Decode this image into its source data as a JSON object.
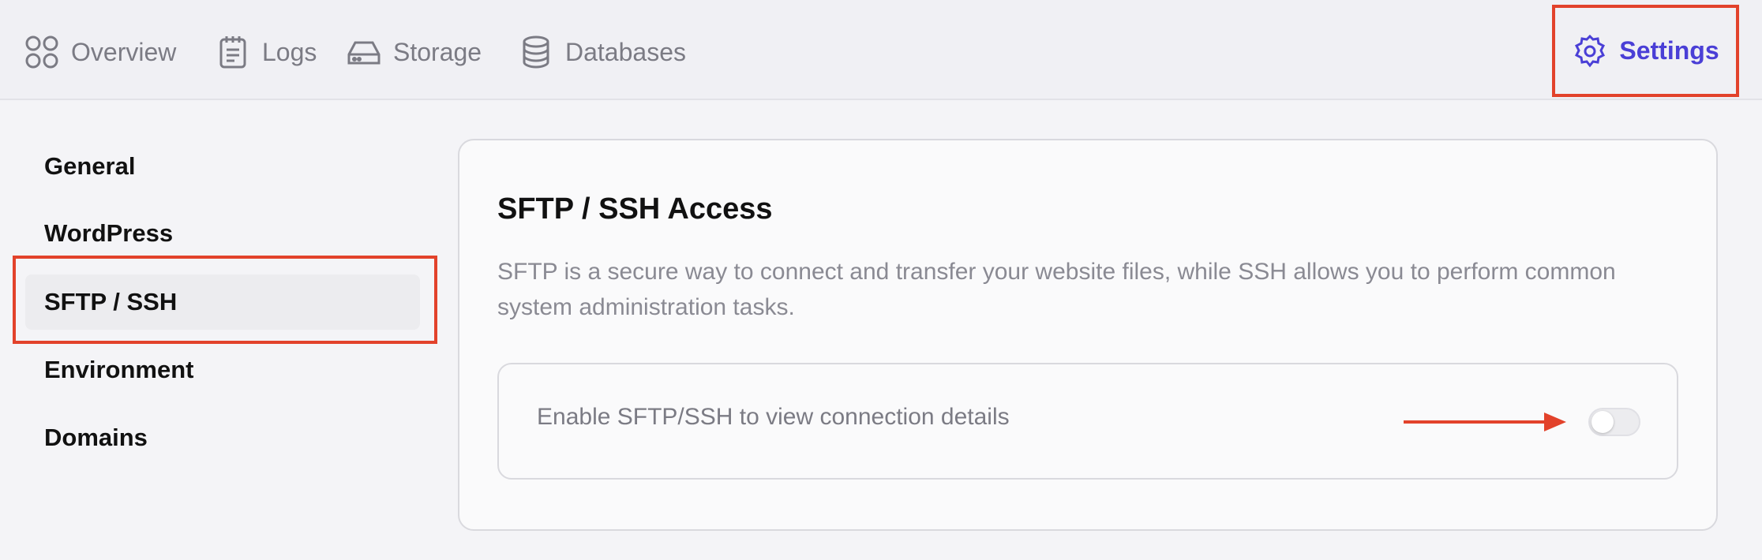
{
  "topnav": {
    "items": [
      {
        "label": "Overview",
        "icon": "overview-grid-icon"
      },
      {
        "label": "Logs",
        "icon": "clipboard-icon"
      },
      {
        "label": "Storage",
        "icon": "hard-drive-icon"
      },
      {
        "label": "Databases",
        "icon": "database-icon"
      }
    ],
    "settings": {
      "label": "Settings",
      "icon": "gear-icon",
      "active": true
    }
  },
  "sidebar": {
    "items": [
      {
        "label": "General"
      },
      {
        "label": "WordPress"
      },
      {
        "label": "SFTP / SSH",
        "active": true
      },
      {
        "label": "Environment"
      },
      {
        "label": "Domains"
      }
    ]
  },
  "main": {
    "title": "SFTP / SSH Access",
    "description": "SFTP is a secure way to connect and transfer your website files, while SSH allows you to perform common system administration tasks.",
    "toggle_label": "Enable SFTP/SSH to view connection details",
    "toggle_enabled": false
  },
  "colors": {
    "accent": "#4a3fd6",
    "highlight": "#e2422b"
  }
}
